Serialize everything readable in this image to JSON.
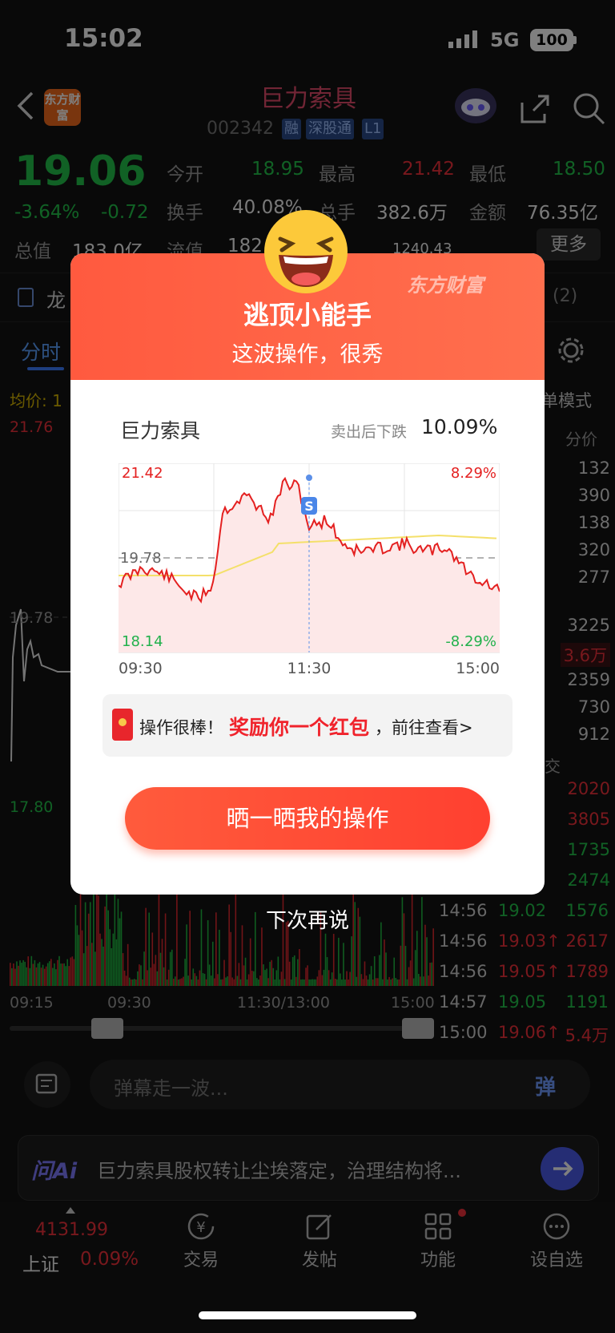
{
  "status": {
    "time": "15:02",
    "network": "5G",
    "battery": "100"
  },
  "header": {
    "title": "巨力索具",
    "code": "002342",
    "tags": [
      "融",
      "深股通",
      "L1"
    ],
    "logo_text": "东方财富"
  },
  "quote": {
    "price": "19.06",
    "change_pct": "-3.64%",
    "change": "-0.72",
    "total_value_label": "总值",
    "total_value": "183.0亿",
    "open_label": "今开",
    "open": "18.95",
    "high_label": "最高",
    "high": "21.42",
    "low_label": "最低",
    "low": "18.50",
    "turnover_label": "换手",
    "turnover": "40.08%",
    "volume_label": "总手",
    "volume": "382.6万",
    "amount_label": "金额",
    "amount": "76.35亿",
    "float_label": "流值",
    "float_value": "182",
    "extra_value": "1240.43",
    "more_label": "更多"
  },
  "news_row": {
    "label": "龙",
    "count": "(2)"
  },
  "chart_tabs": {
    "active": "分时",
    "mode_label": "单模式"
  },
  "left_chart": {
    "avg_label": "均价: 1",
    "y_top": "21.76",
    "y_mid": "19.78",
    "y_bottom": "17.80",
    "x_labels": [
      "09:15",
      "09:30",
      "11:30/13:00",
      "15:00"
    ]
  },
  "right_panel": {
    "header": "分价",
    "values": [
      "132",
      "390",
      "138",
      "320",
      "277",
      "3225",
      "3.6万",
      "2359",
      "730",
      "912"
    ],
    "trades_header": "交",
    "trade_qty_partial": [
      "2020",
      "3805",
      "1735",
      "2474"
    ],
    "trades": [
      {
        "time": "14:56",
        "price": "19.02",
        "arrow": "",
        "qty": "1576"
      },
      {
        "time": "14:56",
        "price": "19.03",
        "arrow": "↑",
        "qty": "2617"
      },
      {
        "time": "14:56",
        "price": "19.05",
        "arrow": "↑",
        "qty": "1789"
      },
      {
        "time": "14:57",
        "price": "19.05",
        "arrow": "",
        "qty": "1191"
      },
      {
        "time": "15:00",
        "price": "19.06",
        "arrow": "↑",
        "qty": "5.4万"
      }
    ]
  },
  "danmaku": {
    "placeholder": "弹幕走一波...",
    "button": "弹"
  },
  "ai_bar": {
    "label": "问Ai",
    "text": "巨力索具股权转让尘埃落定，治理结构将..."
  },
  "tabbar": {
    "index_value": "4131.99",
    "index_name": "上证",
    "index_change": "0.09%",
    "tabs": [
      "交易",
      "发帖",
      "功能",
      "设自选"
    ]
  },
  "modal": {
    "brand": "东方财富",
    "title": "逃顶小能手",
    "subtitle": "这波操作，很秀",
    "stock_name": "巨力索具",
    "drop_label": "卖出后下跌",
    "drop_value": "10.09%",
    "chart": {
      "y_high": "21.42",
      "y_mid": "19.78",
      "y_low": "18.14",
      "pct_high": "8.29%",
      "pct_low": "-8.29%",
      "x_labels": [
        "09:30",
        "11:30",
        "15:00"
      ],
      "sell_marker": "S"
    },
    "reward_prefix": "操作很棒！",
    "reward_highlight": "奖励你一个红包",
    "reward_suffix": "，前往查看>",
    "share_button": "晒一晒我的操作",
    "later": "下次再说"
  },
  "colors": {
    "up": "#f0313a",
    "down": "#22c34a",
    "accent": "#ff5a3f"
  }
}
